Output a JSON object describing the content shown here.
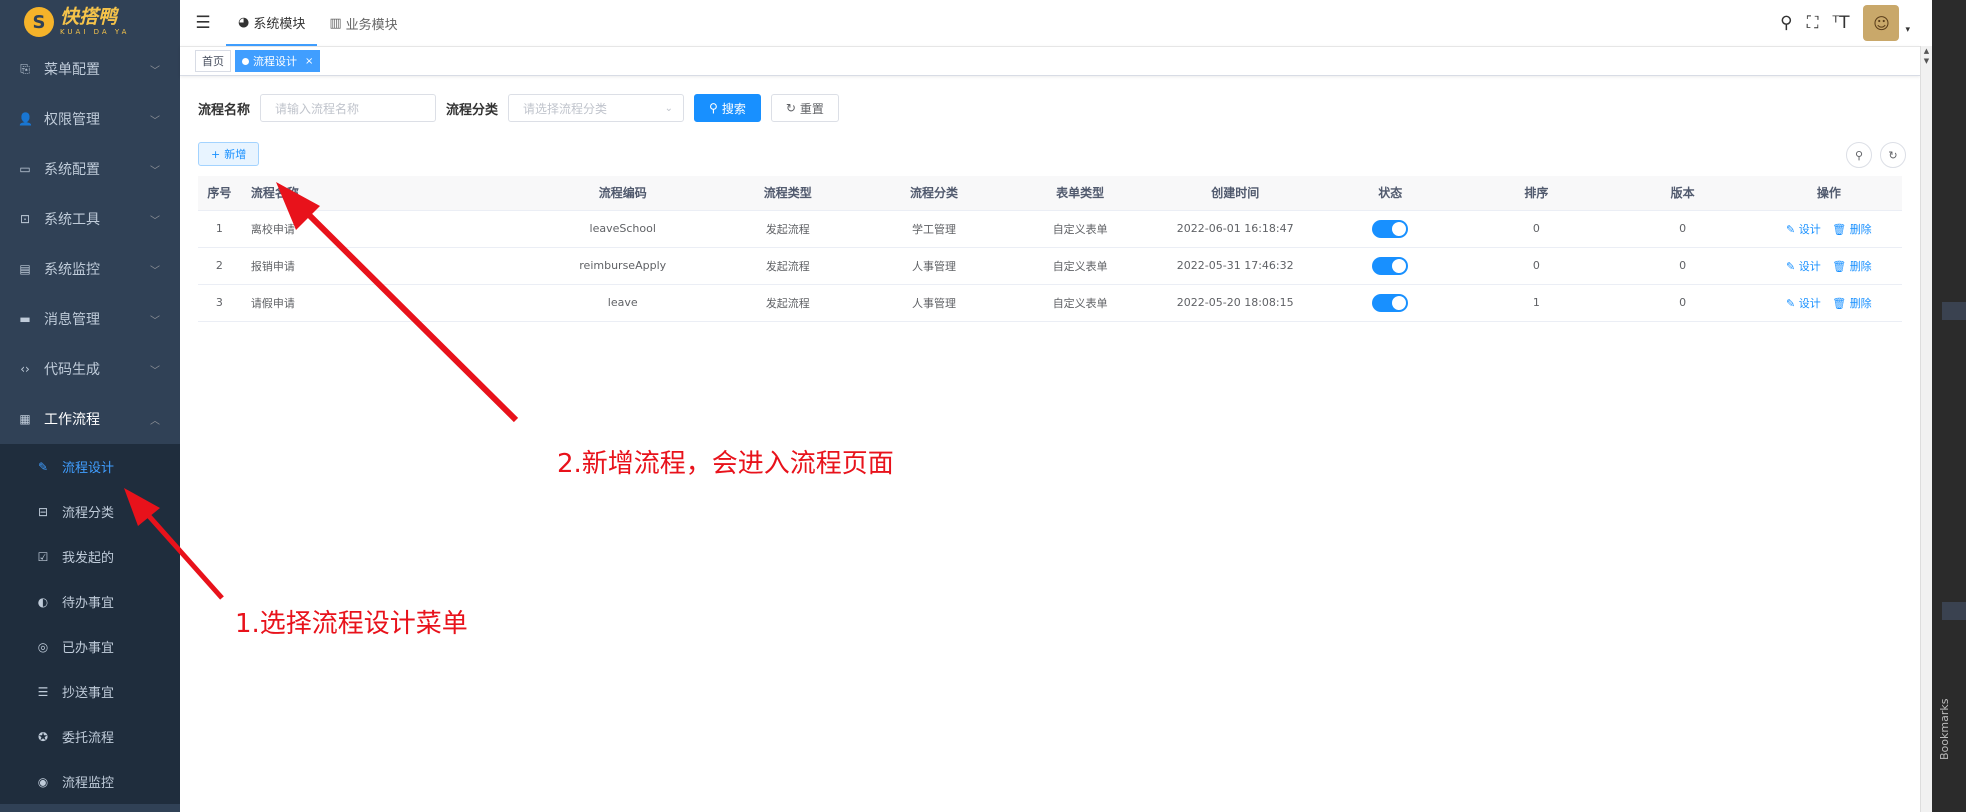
{
  "logo": {
    "cn": "快搭鸭",
    "en": "KUAI DA YA"
  },
  "sidebar": {
    "items": [
      {
        "label": "菜单配置",
        "icon": "menu-config-icon",
        "glyph": "⎘"
      },
      {
        "label": "权限管理",
        "icon": "user-icon",
        "glyph": "👤"
      },
      {
        "label": "系统配置",
        "icon": "monitor-icon",
        "glyph": "▭"
      },
      {
        "label": "系统工具",
        "icon": "toolbox-icon",
        "glyph": "⊡"
      },
      {
        "label": "系统监控",
        "icon": "chart-icon",
        "glyph": "▤"
      },
      {
        "label": "消息管理",
        "icon": "message-icon",
        "glyph": "▬"
      },
      {
        "label": "代码生成",
        "icon": "code-icon",
        "glyph": "‹›"
      },
      {
        "label": "工作流程",
        "icon": "document-icon",
        "glyph": "▦"
      }
    ],
    "subitems": [
      {
        "label": "流程设计",
        "glyph": "✎"
      },
      {
        "label": "流程分类",
        "glyph": "⊟"
      },
      {
        "label": "我发起的",
        "glyph": "☑"
      },
      {
        "label": "待办事宜",
        "glyph": "◐"
      },
      {
        "label": "已办事宜",
        "glyph": "◎"
      },
      {
        "label": "抄送事宜",
        "glyph": "☰"
      },
      {
        "label": "委托流程",
        "glyph": "✪"
      },
      {
        "label": "流程监控",
        "glyph": "◉"
      }
    ]
  },
  "topnav": {
    "modules": [
      {
        "label": "系统模块",
        "glyph": "◕"
      },
      {
        "label": "业务模块",
        "glyph": "▥"
      }
    ]
  },
  "tags": {
    "home": "首页",
    "current": "流程设计",
    "close": "×"
  },
  "search": {
    "name_label": "流程名称",
    "name_placeholder": "请输入流程名称",
    "category_label": "流程分类",
    "category_placeholder": "请选择流程分类",
    "search_btn": "搜索",
    "reset_btn": "重置",
    "add_btn": "新增"
  },
  "table": {
    "headers": [
      "序号",
      "流程名称",
      "流程编码",
      "流程类型",
      "流程分类",
      "表单类型",
      "创建时间",
      "状态",
      "排序",
      "版本",
      "操作"
    ],
    "rows": [
      {
        "no": "1",
        "name": "离校申请",
        "code": "leaveSchool",
        "type": "发起流程",
        "category": "学工管理",
        "form": "自定义表单",
        "time": "2022-06-01 16:18:47",
        "status": true,
        "sort": "0",
        "version": "0"
      },
      {
        "no": "2",
        "name": "报销申请",
        "code": "reimburseApply",
        "type": "发起流程",
        "category": "人事管理",
        "form": "自定义表单",
        "time": "2022-05-31 17:46:32",
        "status": true,
        "sort": "0",
        "version": "0"
      },
      {
        "no": "3",
        "name": "请假申请",
        "code": "leave",
        "type": "发起流程",
        "category": "人事管理",
        "form": "自定义表单",
        "time": "2022-05-20 18:08:15",
        "status": true,
        "sort": "1",
        "version": "0"
      }
    ],
    "op_design": "设计",
    "op_delete": "删除"
  },
  "annotations": {
    "step1": "1.选择流程设计菜单",
    "step2": "2.新增流程，会进入流程页面",
    "color": "#e8121b"
  },
  "side_panel": {
    "bookmarks": "Bookmarks"
  }
}
